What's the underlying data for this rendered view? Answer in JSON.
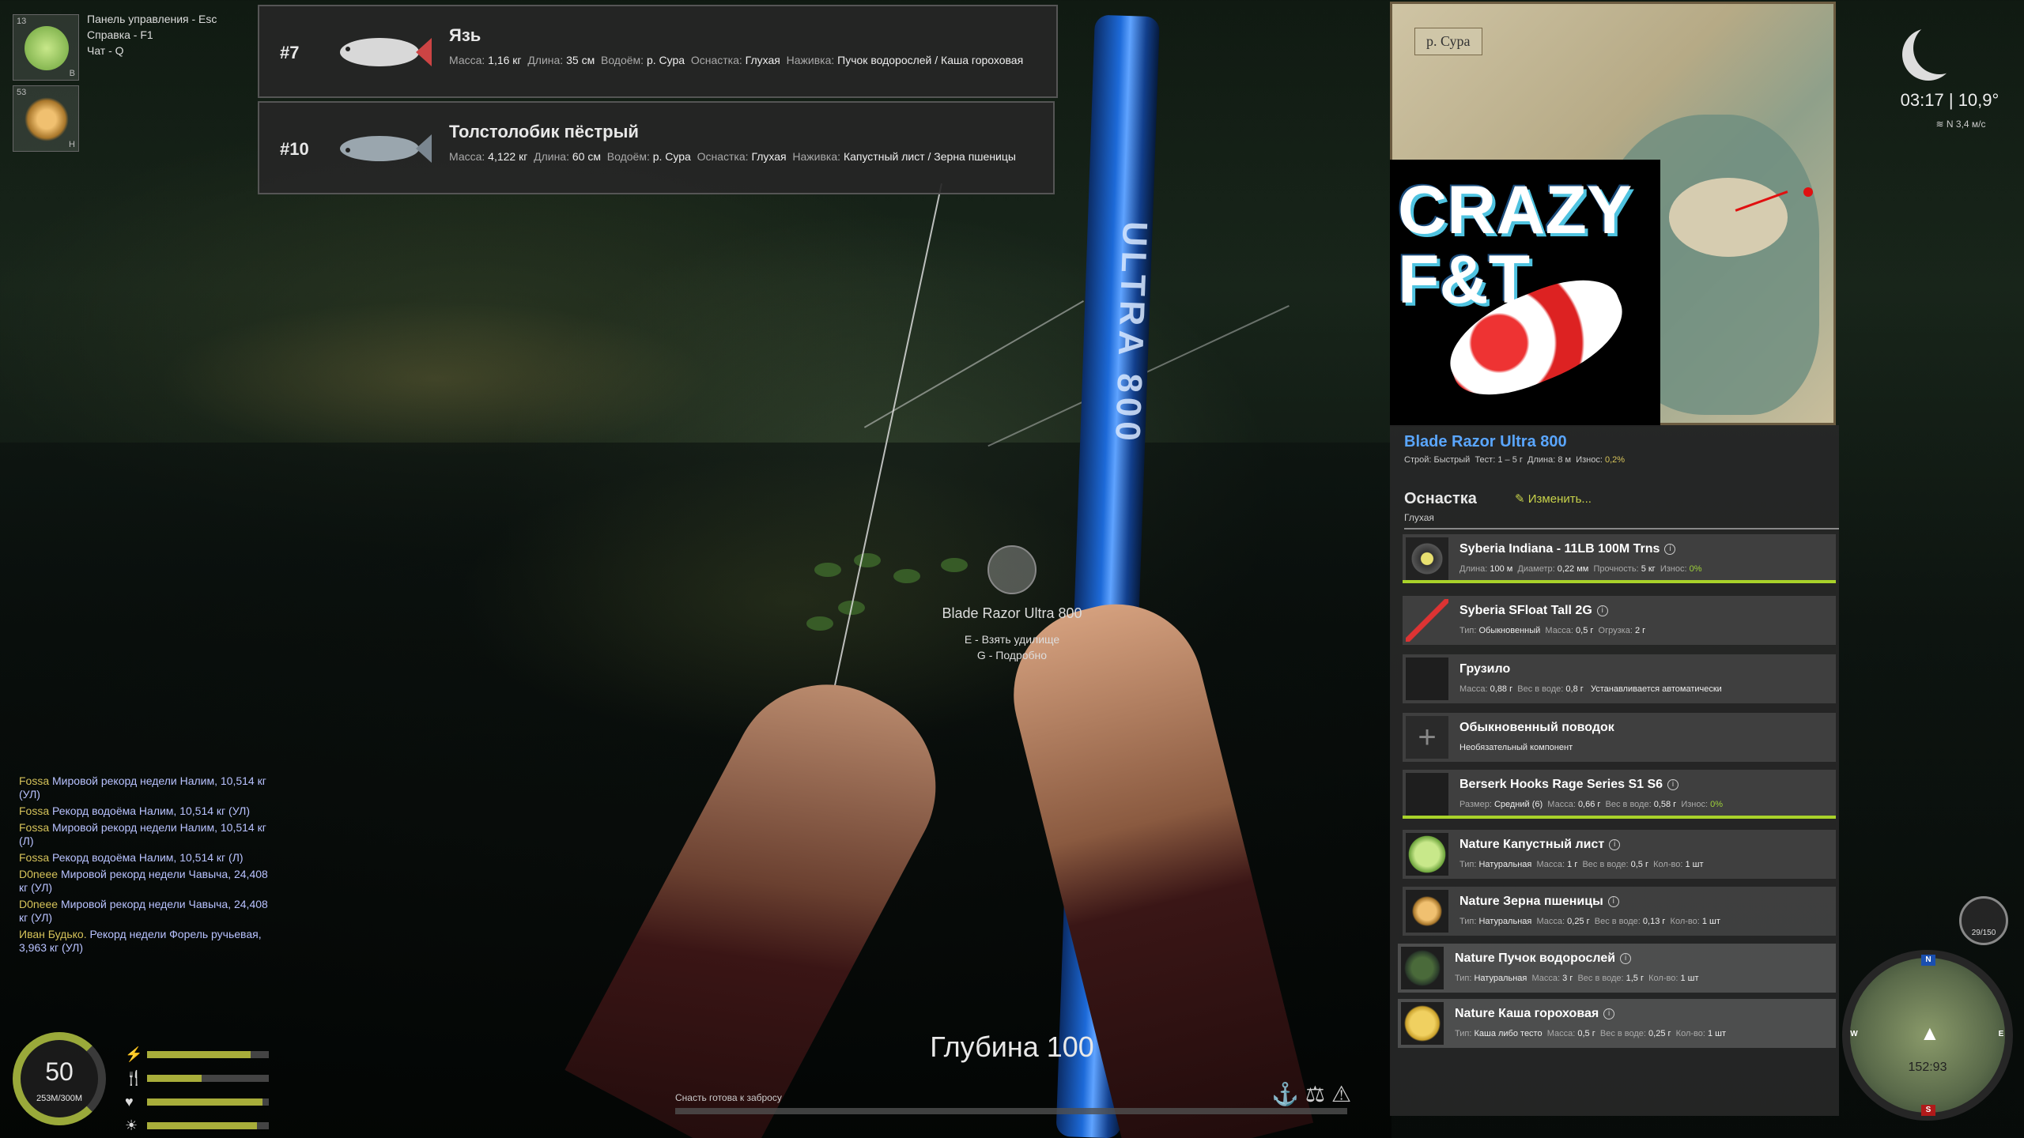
{
  "colors": {
    "accent_green": "#a9d22a",
    "rod_name_blue": "#5aa6ff",
    "chat_nick": "#d6c35a",
    "chat_text": "#b8c2ff",
    "marker_red": "#e01010"
  },
  "hotbar": [
    {
      "slot_number": "13",
      "key": "B",
      "icon": "cabbage-leaf-icon"
    },
    {
      "slot_number": "53",
      "key": "H",
      "icon": "wheat-grain-icon"
    }
  ],
  "hints": [
    "Панель управления - Esc",
    "Справка - F1",
    "Чат - Q"
  ],
  "catches": [
    {
      "rank": "#7",
      "name": "Язь",
      "mass_label": "Масса:",
      "mass": "1,16 кг",
      "length_label": "Длина:",
      "length": "35 см",
      "water_label": "Водоём:",
      "water": "р. Сура",
      "rig_label": "Оснастка:",
      "rig": "Глухая",
      "bait_label": "Наживка:",
      "bait": "Пучок водорослей / Каша гороховая"
    },
    {
      "rank": "#10",
      "name": "Толстолобик пёстрый",
      "mass_label": "Масса:",
      "mass": "4,122 кг",
      "length_label": "Длина:",
      "length": "60 см",
      "water_label": "Водоём:",
      "water": "р. Сура",
      "rig_label": "Оснастка:",
      "rig": "Глухая",
      "bait_label": "Наживка:",
      "bait": "Капустный лист / Зерна пшеницы"
    }
  ],
  "rod_prompt": {
    "title": "Blade Razor Ultra 800",
    "take": "E - Взять удилище",
    "details": "G - Подробно"
  },
  "rod_print": "ULTRA 800",
  "chat": [
    {
      "nick": "Fossa",
      "text": "Мировой рекорд недели Налим, 10,514 кг (УЛ)"
    },
    {
      "nick": "Fossa",
      "text": "Рекорд водоёма Налим, 10,514 кг (УЛ)"
    },
    {
      "nick": "Fossa",
      "text": "Мировой рекорд недели Налим, 10,514 кг (Л)"
    },
    {
      "nick": "Fossa",
      "text": "Рекорд водоёма Налим, 10,514 кг (Л)"
    },
    {
      "nick": "D0neee",
      "text": "Мировой рекорд недели Чавыча, 24,408 кг (УЛ)"
    },
    {
      "nick": "D0neee",
      "text": "Мировой рекорд недели Чавыча, 24,408 кг (УЛ)"
    },
    {
      "nick": "Иван Будько.",
      "text": "Рекорд недели Форель ручьевая, 3,963 кг (УЛ)"
    }
  ],
  "player": {
    "level": "50",
    "xp": "253M/300M",
    "xp_progress": 0.84,
    "stats": [
      {
        "icon": "lightning-icon",
        "value": 0.85
      },
      {
        "icon": "fork-knife-icon",
        "value": 0.45
      },
      {
        "icon": "heart-icon",
        "value": 0.95
      },
      {
        "icon": "sun-icon",
        "value": 0.9
      }
    ]
  },
  "depth_text": "Глубина 100",
  "cast_text": "Снасть готова к забросу",
  "map": {
    "label": "р. Сура"
  },
  "logo_text": "CRAZY F&T",
  "weather": {
    "time": "03:17",
    "temp": "10,9°",
    "wind_dir": "N",
    "wind_speed": "3,4 м/с"
  },
  "rod": {
    "name": "Blade Razor Ultra 800",
    "build_label": "Строй:",
    "build": "Быстрый",
    "test_label": "Тест:",
    "test": "1 – 5 г",
    "length_label": "Длина:",
    "length": "8 м",
    "wear_label": "Износ:",
    "wear": "0,2%"
  },
  "rig": {
    "title": "Оснастка",
    "type": "Глухая",
    "edit": "Изменить..."
  },
  "tackle_items": [
    {
      "name": "Syberia Indiana - 11LB 100M Trns",
      "stats": [
        [
          "Длина:",
          "100 м"
        ],
        [
          "Диаметр:",
          "0,22 мм"
        ],
        [
          "Прочность:",
          "5 кг"
        ],
        [
          "Износ:",
          "0%"
        ]
      ]
    },
    {
      "name": "Syberia SFloat Tall 2G",
      "stats": [
        [
          "Тип:",
          "Обыкновенный"
        ],
        [
          "Масса:",
          "0,5 г"
        ],
        [
          "Огрузка:",
          "2 г"
        ]
      ]
    },
    {
      "name": "Грузило",
      "stats": [
        [
          "Масса:",
          "0,88 г"
        ],
        [
          "Вес в воде:",
          "0,8 г"
        ],
        [
          "",
          "Устанавливается автоматически"
        ]
      ]
    },
    {
      "name": "Обыкновенный поводок",
      "stats": [
        [
          "",
          "Необязательный компонент"
        ]
      ]
    },
    {
      "name": "Berserk Hooks Rage Series S1 S6",
      "stats": [
        [
          "Размер:",
          "Средний (6)"
        ],
        [
          "Масса:",
          "0,66 г"
        ],
        [
          "Вес в воде:",
          "0,58 г"
        ],
        [
          "Износ:",
          "0%"
        ]
      ]
    },
    {
      "name": "Nature Капустный лист",
      "stats": [
        [
          "Тип:",
          "Натуральная"
        ],
        [
          "Масса:",
          "1 г"
        ],
        [
          "Вес в воде:",
          "0,5 г"
        ],
        [
          "Кол-во:",
          "1 шт"
        ]
      ]
    },
    {
      "name": "Nature Зерна пшеницы",
      "stats": [
        [
          "Тип:",
          "Натуральная"
        ],
        [
          "Масса:",
          "0,25 г"
        ],
        [
          "Вес в воде:",
          "0,13 г"
        ],
        [
          "Кол-во:",
          "1 шт"
        ]
      ]
    },
    {
      "name": "Nature Пучок водорослей",
      "stats": [
        [
          "Тип:",
          "Натуральная"
        ],
        [
          "Масса:",
          "3 г"
        ],
        [
          "Вес в воде:",
          "1,5 г"
        ],
        [
          "Кол-во:",
          "1 шт"
        ]
      ]
    },
    {
      "name": "Nature Каша гороховая",
      "stats": [
        [
          "Тип:",
          "Каша либо тесто"
        ],
        [
          "Масса:",
          "0,5 г"
        ],
        [
          "Вес в воде:",
          "0,25 г"
        ],
        [
          "Кол-во:",
          "1 шт"
        ]
      ]
    }
  ],
  "minimap": {
    "coords": "152:93",
    "n": "N",
    "s": "S",
    "w": "W",
    "e": "E"
  },
  "keepnet": "29/150"
}
